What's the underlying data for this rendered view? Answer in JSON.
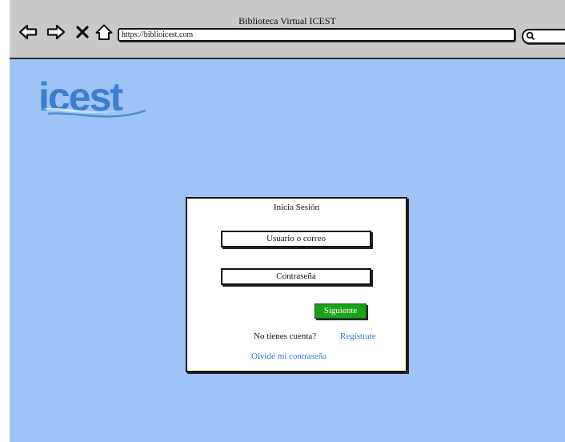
{
  "window": {
    "title": "Biblioteca Virtual ICEST"
  },
  "browser": {
    "url": "https://biblioicest.com",
    "icons": [
      "back-arrow-icon",
      "forward-arrow-icon",
      "close-x-icon",
      "home-icon",
      "search-icon"
    ]
  },
  "brand": {
    "logo_text": "icest",
    "logo_color": "#3a7fd0"
  },
  "login": {
    "title": "Inicia Sesión",
    "user_label": "Usuario o correo",
    "password_label": "Contraseña",
    "next_button": "Siguiente",
    "no_account_text": "No tienes cuenta?",
    "register_link": "Regístrate",
    "forgot_link": "Olvidé mi contraseña"
  },
  "colors": {
    "page_background": "#9ec3f6",
    "chrome_background": "#c9c9c9",
    "primary_button": "#1aa31a",
    "link": "#2a7be0"
  }
}
